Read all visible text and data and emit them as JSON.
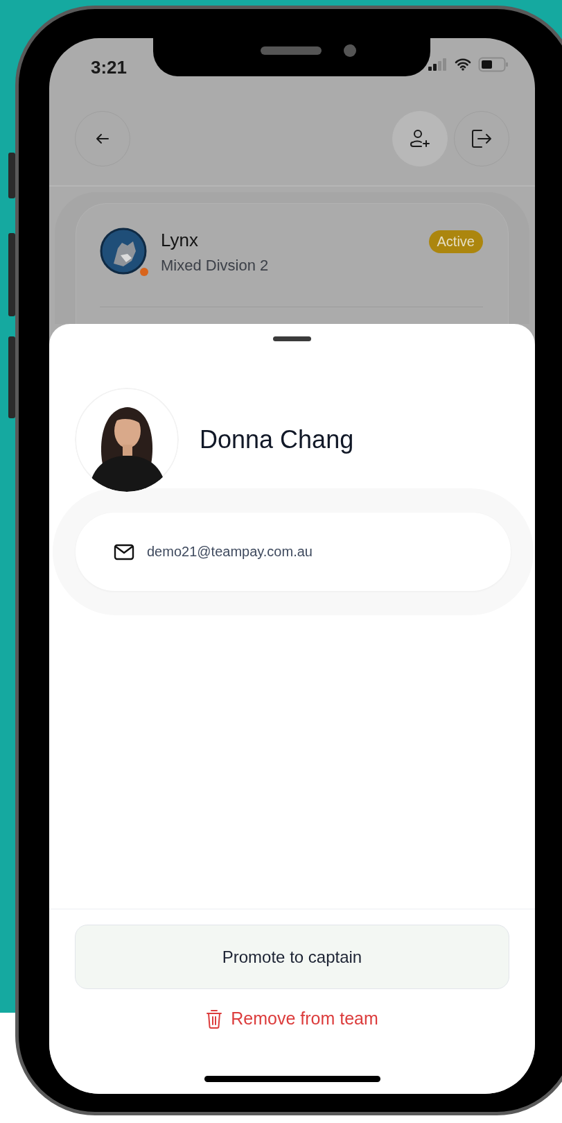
{
  "status_bar": {
    "time": "3:21"
  },
  "header": {
    "actions": [
      {
        "kind": "back",
        "selected": false
      },
      {
        "kind": "add_member",
        "selected": true
      },
      {
        "kind": "leave",
        "selected": false
      }
    ]
  },
  "team": {
    "name": "Lynx",
    "division": "Mixed Divsion 2",
    "status": "Active"
  },
  "sheet": {
    "member": {
      "name": "Donna Chang"
    },
    "contacts": [
      {
        "kind": "email",
        "value": "demo21@teampay.com.au"
      }
    ],
    "actions": [
      {
        "kind": "primary",
        "label": "Promote to captain"
      },
      {
        "kind": "danger",
        "label": "Remove from team"
      }
    ]
  }
}
